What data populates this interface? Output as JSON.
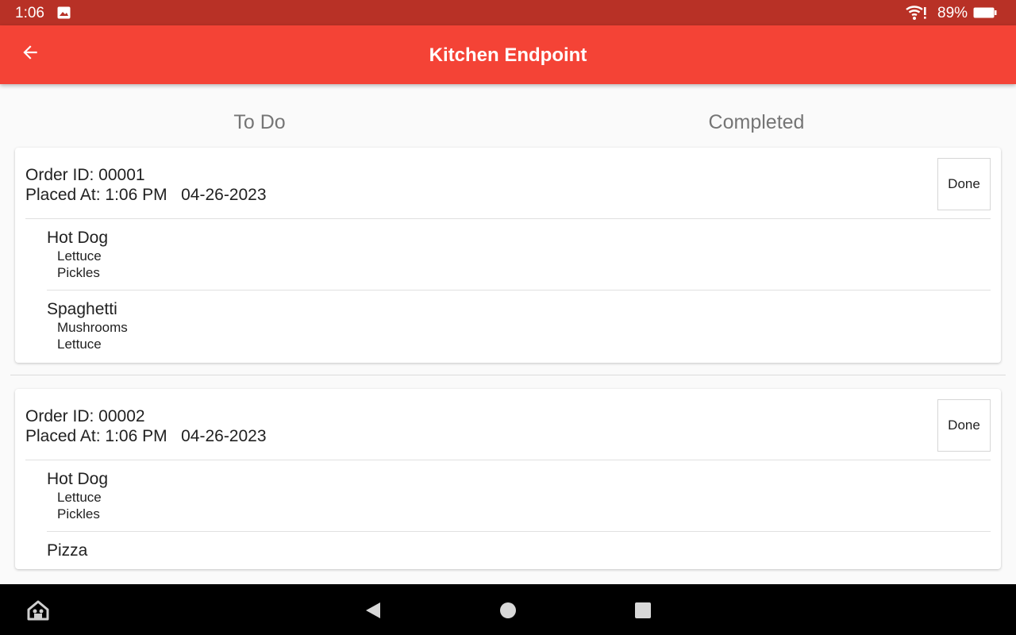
{
  "status_bar": {
    "time": "1:06",
    "battery": "89%",
    "icons": [
      "image-icon",
      "wifi-alert-icon",
      "battery-icon"
    ]
  },
  "app_bar": {
    "title": "Kitchen Endpoint",
    "back_icon": "arrow-back-icon"
  },
  "tabs": [
    {
      "label": "To Do"
    },
    {
      "label": "Completed"
    }
  ],
  "orders": [
    {
      "order_id": "Order ID: 00001",
      "placed_at": "Placed At: 1:06 PM   04-26-2023",
      "done_label": "Done",
      "items": [
        {
          "name": "Hot Dog",
          "toppings": [
            "Lettuce",
            "Pickles"
          ]
        },
        {
          "name": "Spaghetti",
          "toppings": [
            "Mushrooms",
            "Lettuce"
          ]
        }
      ]
    },
    {
      "order_id": "Order ID: 00002",
      "placed_at": "Placed At: 1:06 PM   04-26-2023",
      "done_label": "Done",
      "items": [
        {
          "name": "Hot Dog",
          "toppings": [
            "Lettuce",
            "Pickles"
          ]
        },
        {
          "name": "Pizza",
          "toppings": []
        }
      ]
    }
  ],
  "nav_bar": {
    "icons": [
      "home-assistant-icon",
      "back-triangle-icon",
      "home-circle-icon",
      "recents-square-icon"
    ]
  },
  "colors": {
    "status_bar": "#b83126",
    "app_bar": "#f44336",
    "background": "#fafafa",
    "tab_text": "#757575"
  }
}
